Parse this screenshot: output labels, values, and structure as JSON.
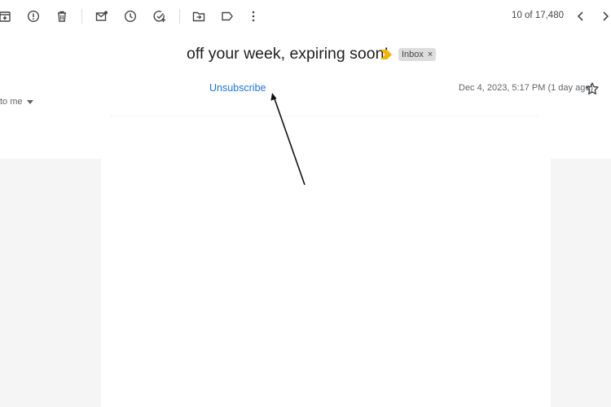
{
  "toolbar": {
    "icons": [
      "archive-icon",
      "report-spam-icon",
      "delete-icon",
      "mark-unread-icon",
      "snooze-icon",
      "add-to-tasks-icon",
      "move-to-icon",
      "label-icon",
      "more-icon"
    ],
    "pager": {
      "count_text": "10 of 17,480"
    }
  },
  "message": {
    "subject": "off your week, expiring soon!",
    "label": "Inbox",
    "label_close": "×",
    "unsubscribe": "Unsubscribe",
    "date": "Dec 4, 2023, 5:17 PM (1 day ago)",
    "recipient": "to me"
  },
  "colors": {
    "importance_marker": "#f4b400",
    "link": "#1a73e8",
    "chip_bg": "#dddddd",
    "body_gray": "#f5f5f5"
  }
}
